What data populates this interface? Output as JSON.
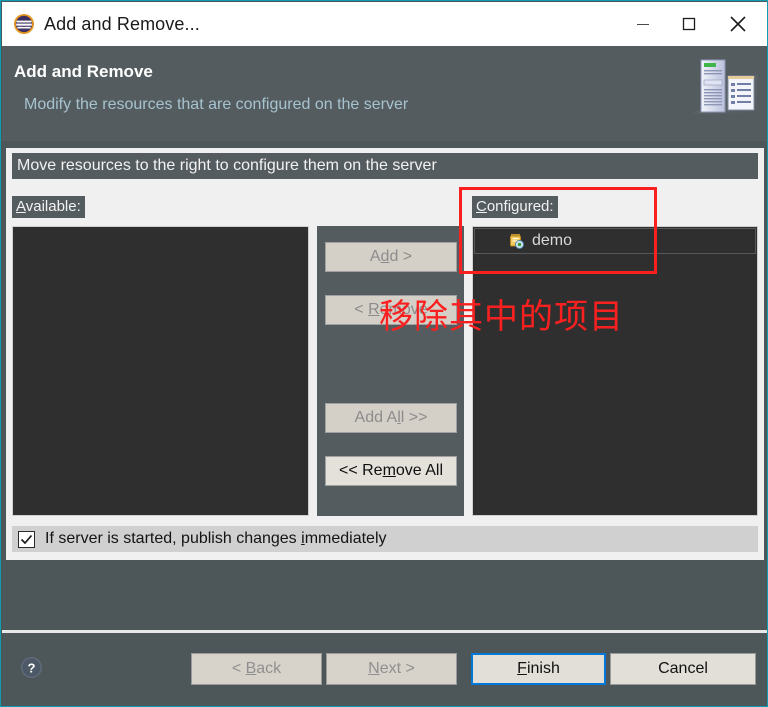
{
  "window": {
    "title": "Add and Remove...",
    "title_icon": "eclipse-logo-icon",
    "border_color": "#0e9cb0",
    "controls": {
      "minimize": "minimize-icon",
      "maximize": "maximize-icon",
      "close": "close-icon"
    }
  },
  "header": {
    "title": "Add and Remove",
    "description": "Modify the resources that are configured on the server",
    "art": "server-and-document-icon",
    "title_color": "#ffffff",
    "description_color": "#a7c3cf",
    "background": "#545c5f"
  },
  "content": {
    "instruction": "Move resources to the right to configure them on the server",
    "available": {
      "label_prefix": "A",
      "label_rest": "vailable:",
      "items": []
    },
    "configured": {
      "label_prefix": "C",
      "label_rest": "onfigured:",
      "items": [
        {
          "label": "demo",
          "icon": "module-package-icon"
        }
      ]
    },
    "transfer_buttons": [
      {
        "name": "add-button",
        "before": "A",
        "mnemonic": "d",
        "after": "d >",
        "enabled": false
      },
      {
        "name": "remove-button",
        "before": "< ",
        "mnemonic": "R",
        "after": "emove",
        "enabled": false
      },
      {
        "name": "add-all-button",
        "before": "Add A",
        "mnemonic": "l",
        "after": "l >>",
        "enabled": false
      },
      {
        "name": "remove-all-button",
        "before": "<< Re",
        "mnemonic": "m",
        "after": "ove All",
        "enabled": true
      }
    ],
    "publish_checkbox": {
      "checked": true,
      "label_before": "If server is started, publish changes ",
      "label_mnemonic": "i",
      "label_after": "mmediately"
    }
  },
  "footer": {
    "help_icon": "help-question-icon",
    "buttons": [
      {
        "name": "back-button",
        "before": "< ",
        "mnemonic": "B",
        "after": "ack",
        "enabled": false,
        "default": false
      },
      {
        "name": "next-button",
        "before": "",
        "mnemonic": "N",
        "after": "ext >",
        "enabled": false,
        "default": false
      },
      {
        "name": "finish-button",
        "before": "",
        "mnemonic": "F",
        "after": "inish",
        "enabled": true,
        "default": true
      },
      {
        "name": "cancel-button",
        "before": "Cancel",
        "mnemonic": "",
        "after": "",
        "enabled": true,
        "default": false
      }
    ]
  },
  "annotations": {
    "highlight_color": "#fb2020",
    "note_text": "移除其中的项目"
  }
}
